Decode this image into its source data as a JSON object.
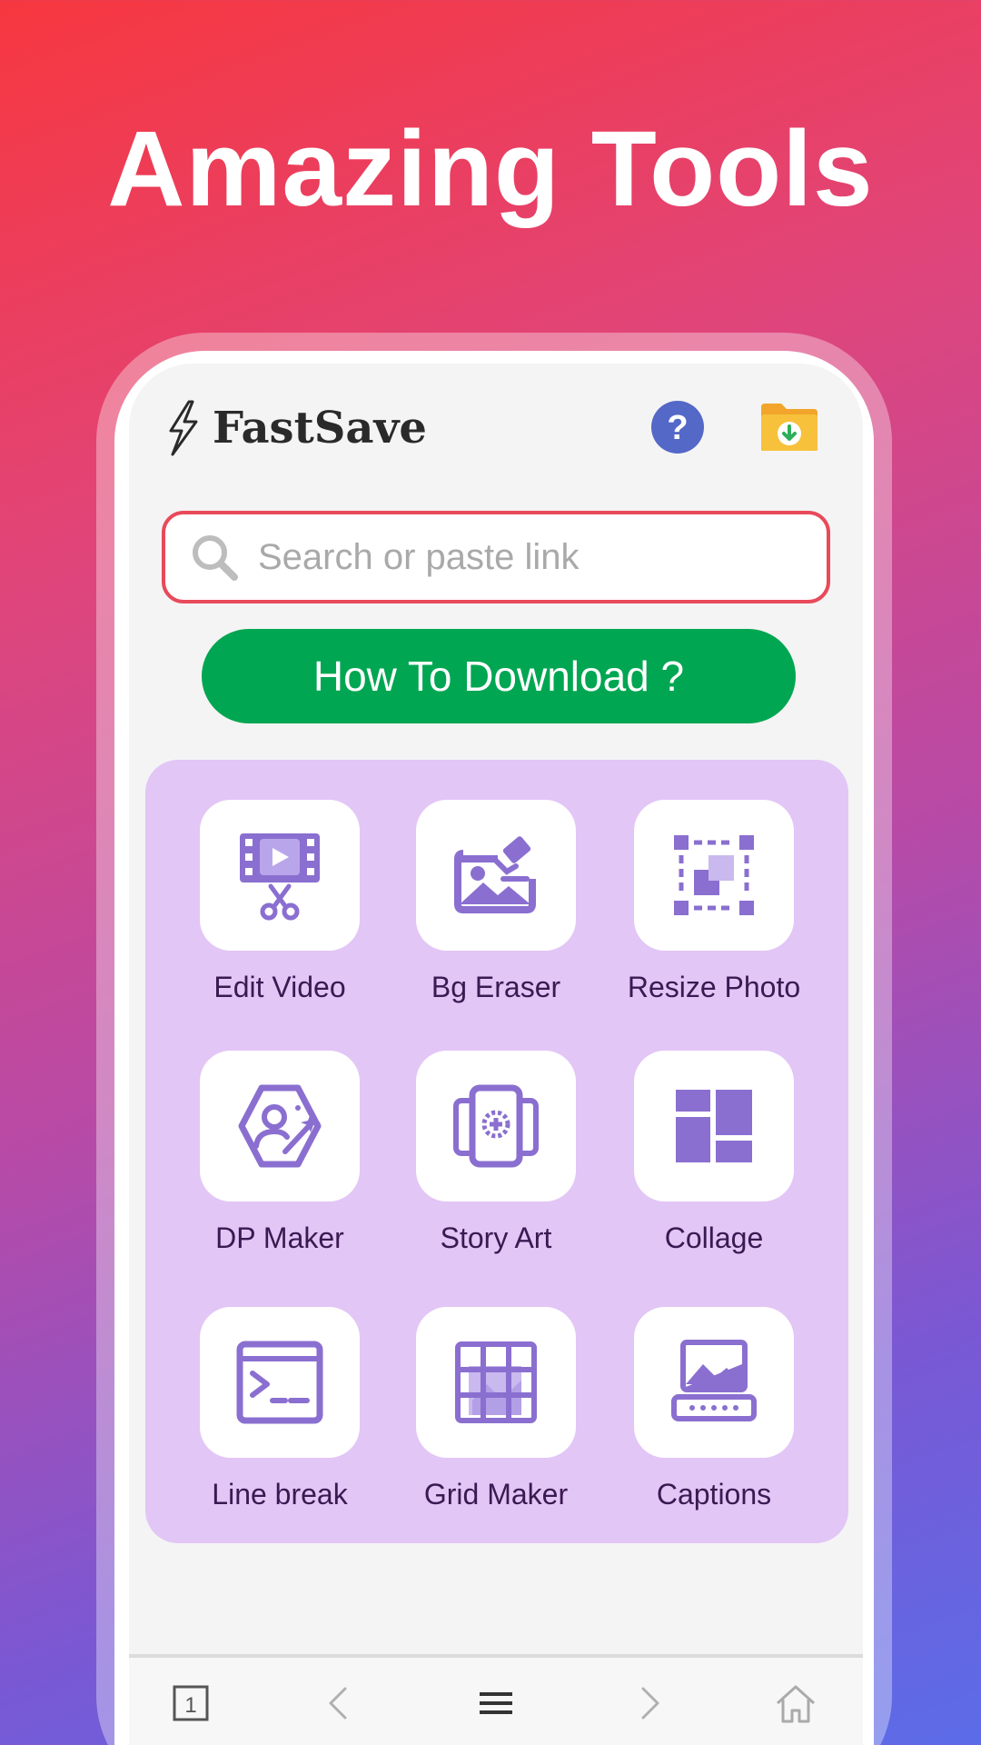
{
  "headline": "Amazing Tools",
  "app": {
    "name": "FastSave",
    "help_icon": "question-circle-icon",
    "downloads_icon": "download-folder-icon"
  },
  "search": {
    "placeholder": "Search or paste link",
    "value": ""
  },
  "how_to_download": "How To Download ?",
  "tools": [
    {
      "label": "Edit Video",
      "icon": "video-scissors-icon"
    },
    {
      "label": "Bg Eraser",
      "icon": "image-eraser-icon"
    },
    {
      "label": "Resize Photo",
      "icon": "resize-icon"
    },
    {
      "label": "DP Maker",
      "icon": "profile-sparkle-icon"
    },
    {
      "label": "Story Art",
      "icon": "story-frames-icon"
    },
    {
      "label": "Collage",
      "icon": "collage-icon"
    },
    {
      "label": "Line break",
      "icon": "terminal-icon"
    },
    {
      "label": "Grid Maker",
      "icon": "grid-icon"
    },
    {
      "label": "Captions",
      "icon": "image-keyboard-icon"
    }
  ],
  "bottom_nav": {
    "tab_count": "1",
    "icons": [
      "tabs-icon",
      "back-icon",
      "menu-icon",
      "forward-icon",
      "home-icon"
    ]
  },
  "colors": {
    "accent_green": "#00a651",
    "search_border": "#e84a5a",
    "tool_panel": "#e2c6f6",
    "tool_icon": "#8a6fd0"
  }
}
